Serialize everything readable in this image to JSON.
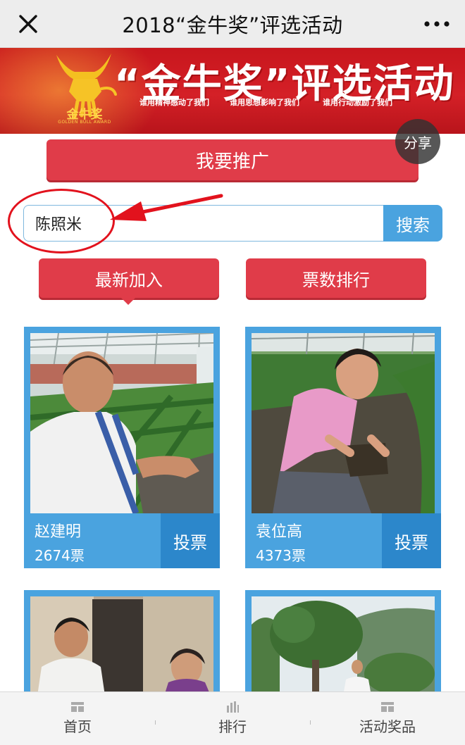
{
  "navbar": {
    "title": "2018“金牛奖”评选活动"
  },
  "banner": {
    "title": "“金牛奖”评选活动",
    "brand": "金牛奖",
    "brand_en": "GOLDEN BULL AWARD",
    "slogans": [
      "谁用精神感动了我们",
      "谁用思想影响了我们",
      "谁用行动激励了我们"
    ]
  },
  "share": {
    "label": "分享"
  },
  "promote": {
    "label": "我要推广"
  },
  "search": {
    "value": "陈照米",
    "button_label": "搜索"
  },
  "sort_tabs": [
    {
      "label": "最新加入",
      "active": true
    },
    {
      "label": "票数排行",
      "active": false
    }
  ],
  "candidates": [
    {
      "name": "赵建明",
      "votes": "2674票",
      "vote_label": "投票"
    },
    {
      "name": "袁位高",
      "votes": "4373票",
      "vote_label": "投票"
    },
    {
      "name": "",
      "votes": "",
      "vote_label": ""
    },
    {
      "name": "",
      "votes": "",
      "vote_label": ""
    }
  ],
  "tabbar": [
    {
      "label": "首页",
      "icon": "home-grid-icon"
    },
    {
      "label": "排行",
      "icon": "bar-chart-icon"
    },
    {
      "label": "活动奖品",
      "icon": "prize-grid-icon"
    }
  ],
  "colors": {
    "accent_red": "#e03c49",
    "card_blue": "#4aa3df",
    "vote_blue": "#2c87cb",
    "banner_red": "#d42027"
  }
}
